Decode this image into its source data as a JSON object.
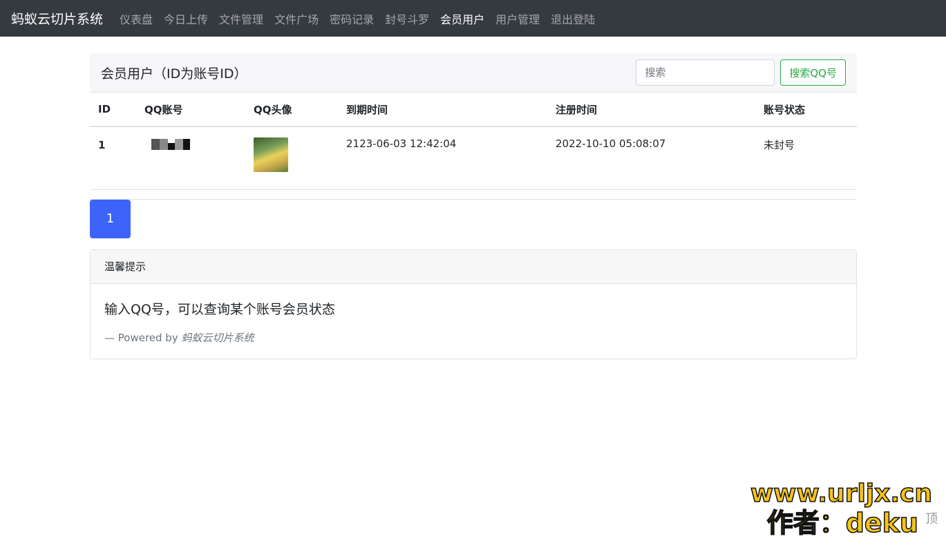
{
  "navbar": {
    "brand": "蚂蚁云切片系统",
    "items": [
      {
        "label": "仪表盘",
        "active": false
      },
      {
        "label": "今日上传",
        "active": false
      },
      {
        "label": "文件管理",
        "active": false
      },
      {
        "label": "文件广场",
        "active": false
      },
      {
        "label": "密码记录",
        "active": false
      },
      {
        "label": "封号斗罗",
        "active": false
      },
      {
        "label": "会员用户",
        "active": true
      },
      {
        "label": "用户管理",
        "active": false
      },
      {
        "label": "退出登陆",
        "active": false
      }
    ]
  },
  "panel": {
    "title": "会员用户（ID为账号ID）",
    "search_placeholder": "搜索",
    "search_button": "搜索QQ号"
  },
  "table": {
    "headers": [
      "ID",
      "QQ账号",
      "QQ头像",
      "到期时间",
      "注册时间",
      "账号状态"
    ],
    "rows": [
      {
        "id": "1",
        "qq": "",
        "expire": "2123-06-03 12:42:04",
        "register": "2022-10-10 05:08:07",
        "status": "未封号"
      }
    ]
  },
  "pagination": {
    "current": "1"
  },
  "tip": {
    "header": "温馨提示",
    "text": "输入QQ号，可以查询某个账号会员状态",
    "footer_prefix": "— Powered by ",
    "footer_source": "蚂蚁云切片系统"
  },
  "watermark": {
    "url": "www.urljx.cn",
    "author": "作者：deku"
  },
  "side_widget": {
    "label": "顶"
  }
}
